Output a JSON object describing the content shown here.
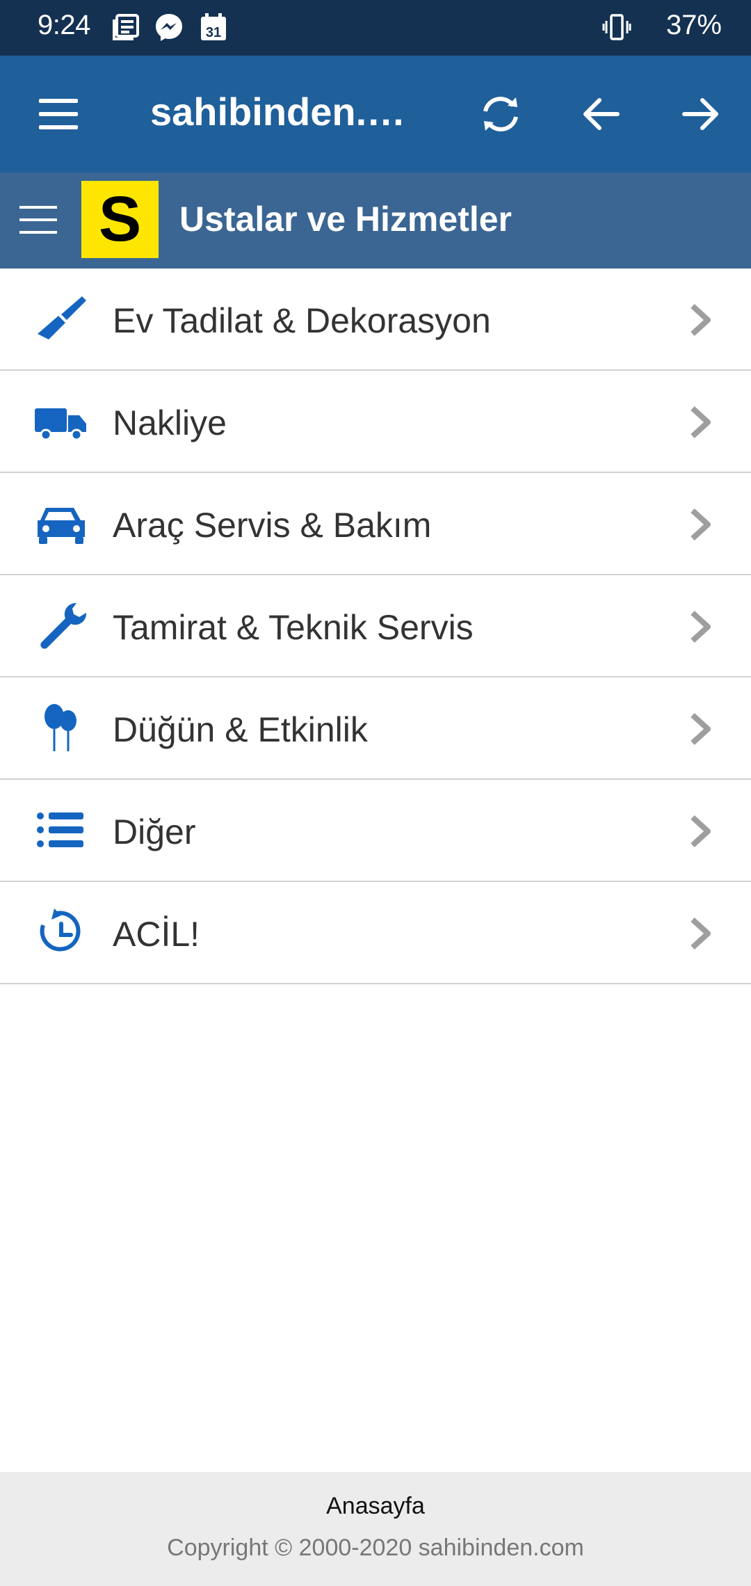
{
  "status_bar": {
    "time": "9:24",
    "calendar_day": "31",
    "battery": "37%",
    "icons": [
      "news-icon",
      "messenger-icon",
      "calendar-icon",
      "vibrate-icon"
    ]
  },
  "app_bar": {
    "title": "sahibinden.com",
    "icons": [
      "menu-icon",
      "refresh-icon",
      "back-arrow-icon",
      "forward-arrow-icon"
    ]
  },
  "site_header": {
    "logo": "S",
    "title": "Ustalar ve Hizmetler"
  },
  "categories": [
    {
      "label": "Ev Tadilat & Dekorasyon",
      "icon": "paint-brush-icon"
    },
    {
      "label": "Nakliye",
      "icon": "truck-icon"
    },
    {
      "label": "Araç Servis & Bakım",
      "icon": "car-icon"
    },
    {
      "label": "Tamirat & Teknik Servis",
      "icon": "wrench-icon"
    },
    {
      "label": "Düğün & Etkinlik",
      "icon": "balloons-icon"
    },
    {
      "label": "Diğer",
      "icon": "list-icon"
    },
    {
      "label": "ACİL!",
      "icon": "clock-icon"
    }
  ],
  "footer": {
    "home_link": "Anasayfa",
    "copyright": "Copyright © 2000-2020 sahibinden.com"
  },
  "colors": {
    "status_bar": "#143152",
    "app_bar": "#1f5f9a",
    "site_header": "#3b6693",
    "logo_bg": "#ffe600",
    "icon_blue": "#1565c0",
    "chevron": "#9e9e9e"
  }
}
